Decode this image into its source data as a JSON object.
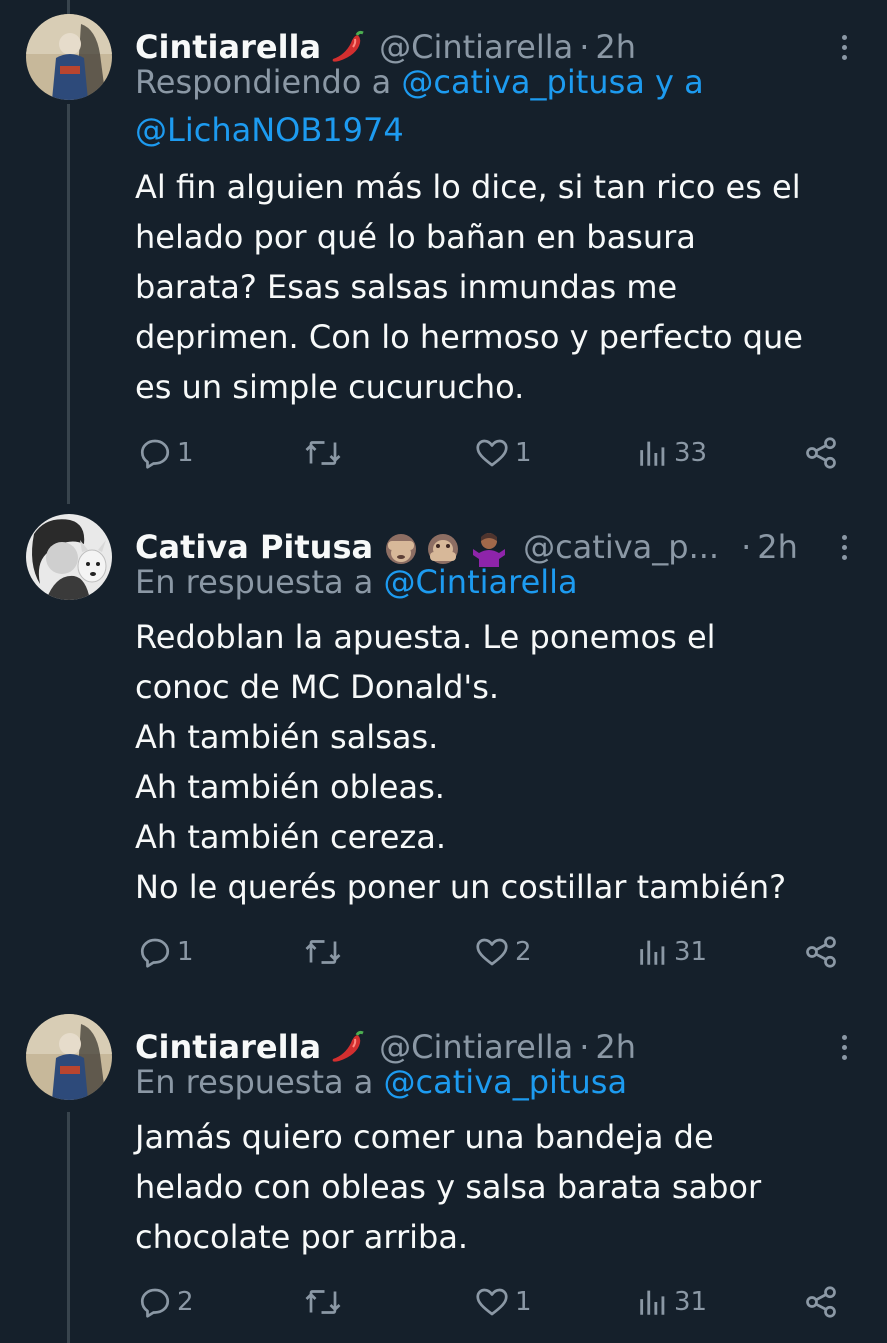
{
  "tweets": [
    {
      "name": "Cintiarella",
      "emoji": "🌶️",
      "handle": "@Cintiarella",
      "separator": "·",
      "time": "2h",
      "reply_prefix": "Respondiendo a ",
      "reply_mention_1": "@cativa_pitusa",
      "reply_joiner": " y a",
      "reply_mention_2": "@LichaNOB1974",
      "lines": [
        "Al fin alguien más lo dice, si tan rico es el",
        "helado por qué lo bañan en basura",
        "barata? Esas salsas inmundas me",
        "deprimen. Con lo hermoso y perfecto que",
        "es un simple cucurucho."
      ],
      "replies": "1",
      "retweets": "",
      "likes": "1",
      "views": "33"
    },
    {
      "name": "Cativa Pitusa",
      "emoji": "🙈🙊🤷🏽‍♀️",
      "handle": "@cativa_p...",
      "separator": "·",
      "time": "2h",
      "reply_prefix": "En respuesta a ",
      "reply_mention_1": "@Cintiarella",
      "lines": [
        "Redoblan la apuesta. Le ponemos el",
        "conoc de MC Donald's.",
        "Ah también salsas.",
        "Ah también obleas.",
        "Ah también cereza.",
        "No le querés poner un costillar también?"
      ],
      "replies": "1",
      "retweets": "",
      "likes": "2",
      "views": "31"
    },
    {
      "name": "Cintiarella",
      "emoji": "🌶️",
      "handle": "@Cintiarella",
      "separator": "·",
      "time": "2h",
      "reply_prefix": "En respuesta a ",
      "reply_mention_1": "@cativa_pitusa",
      "lines": [
        "Jamás quiero comer una bandeja de",
        "helado con obleas y salsa barata sabor",
        "chocolate por arriba."
      ],
      "replies": "2",
      "retweets": "",
      "likes": "1",
      "views": "31"
    }
  ],
  "colors": {
    "background": "#15202b",
    "secondary_text": "#8b98a5",
    "link": "#1d9bf0",
    "thread_line": "#38444d"
  },
  "icons": {
    "reply": "reply-icon",
    "retweet": "retweet-icon",
    "like": "heart-icon",
    "views": "views-icon",
    "share": "share-icon",
    "more": "more-options-icon"
  }
}
